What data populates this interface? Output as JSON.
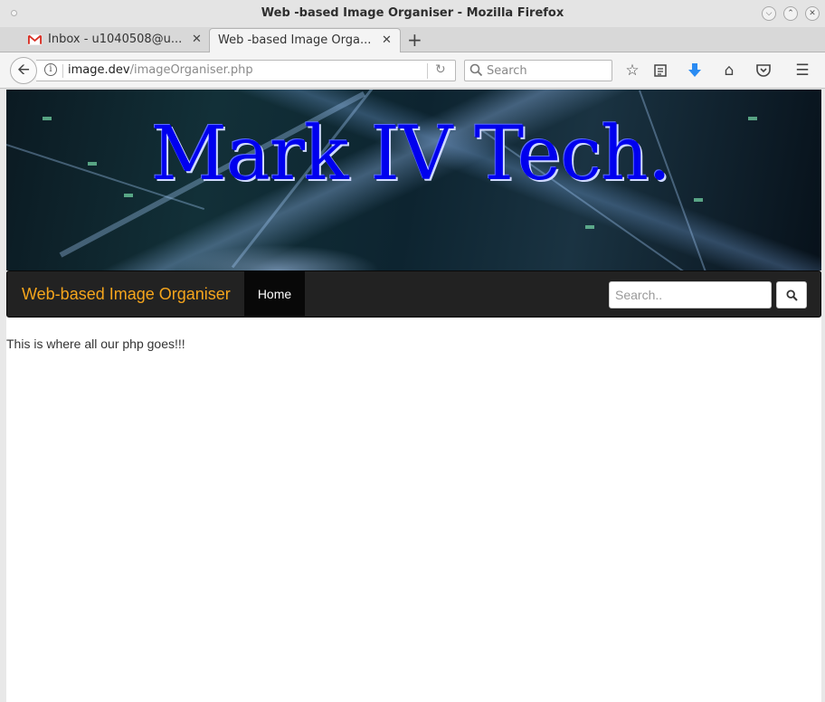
{
  "window": {
    "title": "Web -based Image Organiser - Mozilla Firefox"
  },
  "tabs": [
    {
      "label": "Inbox - u1040508@u...",
      "icon": "gmail-icon",
      "active": false
    },
    {
      "label": "Web -based Image Orga...",
      "active": true
    }
  ],
  "nav": {
    "url_host": "image.dev",
    "url_path": "/imageOrganiser.php",
    "search_placeholder": "Search"
  },
  "page": {
    "banner_heading": "Mark IV Tech.",
    "brand": "Web-based Image Organiser",
    "home_label": "Home",
    "search_placeholder": "Search..",
    "body_text": "This is where all our php goes!!!"
  },
  "colors": {
    "brand": "#f5a51c",
    "heading": "#0000ee",
    "navbar": "#222222"
  }
}
